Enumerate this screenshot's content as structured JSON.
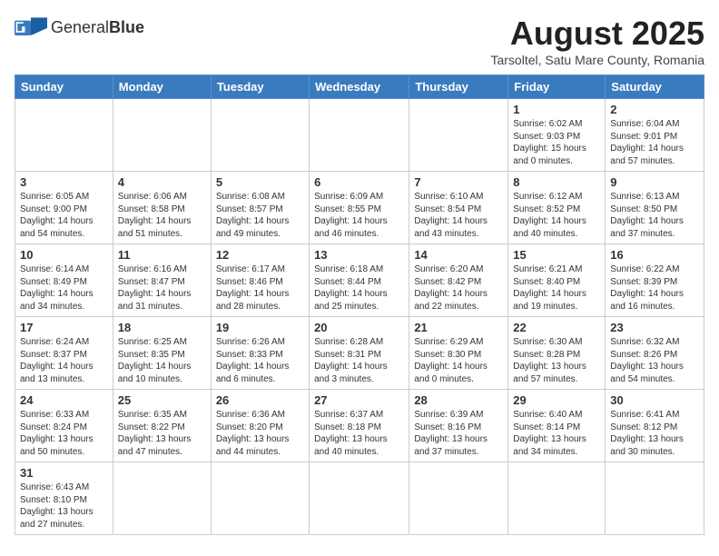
{
  "header": {
    "logo_text_normal": "General",
    "logo_text_bold": "Blue",
    "month_title": "August 2025",
    "subtitle": "Tarsoltel, Satu Mare County, Romania"
  },
  "calendar": {
    "days_of_week": [
      "Sunday",
      "Monday",
      "Tuesday",
      "Wednesday",
      "Thursday",
      "Friday",
      "Saturday"
    ],
    "weeks": [
      [
        {
          "day": "",
          "info": ""
        },
        {
          "day": "",
          "info": ""
        },
        {
          "day": "",
          "info": ""
        },
        {
          "day": "",
          "info": ""
        },
        {
          "day": "",
          "info": ""
        },
        {
          "day": "1",
          "info": "Sunrise: 6:02 AM\nSunset: 9:03 PM\nDaylight: 15 hours and 0 minutes."
        },
        {
          "day": "2",
          "info": "Sunrise: 6:04 AM\nSunset: 9:01 PM\nDaylight: 14 hours and 57 minutes."
        }
      ],
      [
        {
          "day": "3",
          "info": "Sunrise: 6:05 AM\nSunset: 9:00 PM\nDaylight: 14 hours and 54 minutes."
        },
        {
          "day": "4",
          "info": "Sunrise: 6:06 AM\nSunset: 8:58 PM\nDaylight: 14 hours and 51 minutes."
        },
        {
          "day": "5",
          "info": "Sunrise: 6:08 AM\nSunset: 8:57 PM\nDaylight: 14 hours and 49 minutes."
        },
        {
          "day": "6",
          "info": "Sunrise: 6:09 AM\nSunset: 8:55 PM\nDaylight: 14 hours and 46 minutes."
        },
        {
          "day": "7",
          "info": "Sunrise: 6:10 AM\nSunset: 8:54 PM\nDaylight: 14 hours and 43 minutes."
        },
        {
          "day": "8",
          "info": "Sunrise: 6:12 AM\nSunset: 8:52 PM\nDaylight: 14 hours and 40 minutes."
        },
        {
          "day": "9",
          "info": "Sunrise: 6:13 AM\nSunset: 8:50 PM\nDaylight: 14 hours and 37 minutes."
        }
      ],
      [
        {
          "day": "10",
          "info": "Sunrise: 6:14 AM\nSunset: 8:49 PM\nDaylight: 14 hours and 34 minutes."
        },
        {
          "day": "11",
          "info": "Sunrise: 6:16 AM\nSunset: 8:47 PM\nDaylight: 14 hours and 31 minutes."
        },
        {
          "day": "12",
          "info": "Sunrise: 6:17 AM\nSunset: 8:46 PM\nDaylight: 14 hours and 28 minutes."
        },
        {
          "day": "13",
          "info": "Sunrise: 6:18 AM\nSunset: 8:44 PM\nDaylight: 14 hours and 25 minutes."
        },
        {
          "day": "14",
          "info": "Sunrise: 6:20 AM\nSunset: 8:42 PM\nDaylight: 14 hours and 22 minutes."
        },
        {
          "day": "15",
          "info": "Sunrise: 6:21 AM\nSunset: 8:40 PM\nDaylight: 14 hours and 19 minutes."
        },
        {
          "day": "16",
          "info": "Sunrise: 6:22 AM\nSunset: 8:39 PM\nDaylight: 14 hours and 16 minutes."
        }
      ],
      [
        {
          "day": "17",
          "info": "Sunrise: 6:24 AM\nSunset: 8:37 PM\nDaylight: 14 hours and 13 minutes."
        },
        {
          "day": "18",
          "info": "Sunrise: 6:25 AM\nSunset: 8:35 PM\nDaylight: 14 hours and 10 minutes."
        },
        {
          "day": "19",
          "info": "Sunrise: 6:26 AM\nSunset: 8:33 PM\nDaylight: 14 hours and 6 minutes."
        },
        {
          "day": "20",
          "info": "Sunrise: 6:28 AM\nSunset: 8:31 PM\nDaylight: 14 hours and 3 minutes."
        },
        {
          "day": "21",
          "info": "Sunrise: 6:29 AM\nSunset: 8:30 PM\nDaylight: 14 hours and 0 minutes."
        },
        {
          "day": "22",
          "info": "Sunrise: 6:30 AM\nSunset: 8:28 PM\nDaylight: 13 hours and 57 minutes."
        },
        {
          "day": "23",
          "info": "Sunrise: 6:32 AM\nSunset: 8:26 PM\nDaylight: 13 hours and 54 minutes."
        }
      ],
      [
        {
          "day": "24",
          "info": "Sunrise: 6:33 AM\nSunset: 8:24 PM\nDaylight: 13 hours and 50 minutes."
        },
        {
          "day": "25",
          "info": "Sunrise: 6:35 AM\nSunset: 8:22 PM\nDaylight: 13 hours and 47 minutes."
        },
        {
          "day": "26",
          "info": "Sunrise: 6:36 AM\nSunset: 8:20 PM\nDaylight: 13 hours and 44 minutes."
        },
        {
          "day": "27",
          "info": "Sunrise: 6:37 AM\nSunset: 8:18 PM\nDaylight: 13 hours and 40 minutes."
        },
        {
          "day": "28",
          "info": "Sunrise: 6:39 AM\nSunset: 8:16 PM\nDaylight: 13 hours and 37 minutes."
        },
        {
          "day": "29",
          "info": "Sunrise: 6:40 AM\nSunset: 8:14 PM\nDaylight: 13 hours and 34 minutes."
        },
        {
          "day": "30",
          "info": "Sunrise: 6:41 AM\nSunset: 8:12 PM\nDaylight: 13 hours and 30 minutes."
        }
      ],
      [
        {
          "day": "31",
          "info": "Sunrise: 6:43 AM\nSunset: 8:10 PM\nDaylight: 13 hours and 27 minutes."
        },
        {
          "day": "",
          "info": ""
        },
        {
          "day": "",
          "info": ""
        },
        {
          "day": "",
          "info": ""
        },
        {
          "day": "",
          "info": ""
        },
        {
          "day": "",
          "info": ""
        },
        {
          "day": "",
          "info": ""
        }
      ]
    ]
  }
}
